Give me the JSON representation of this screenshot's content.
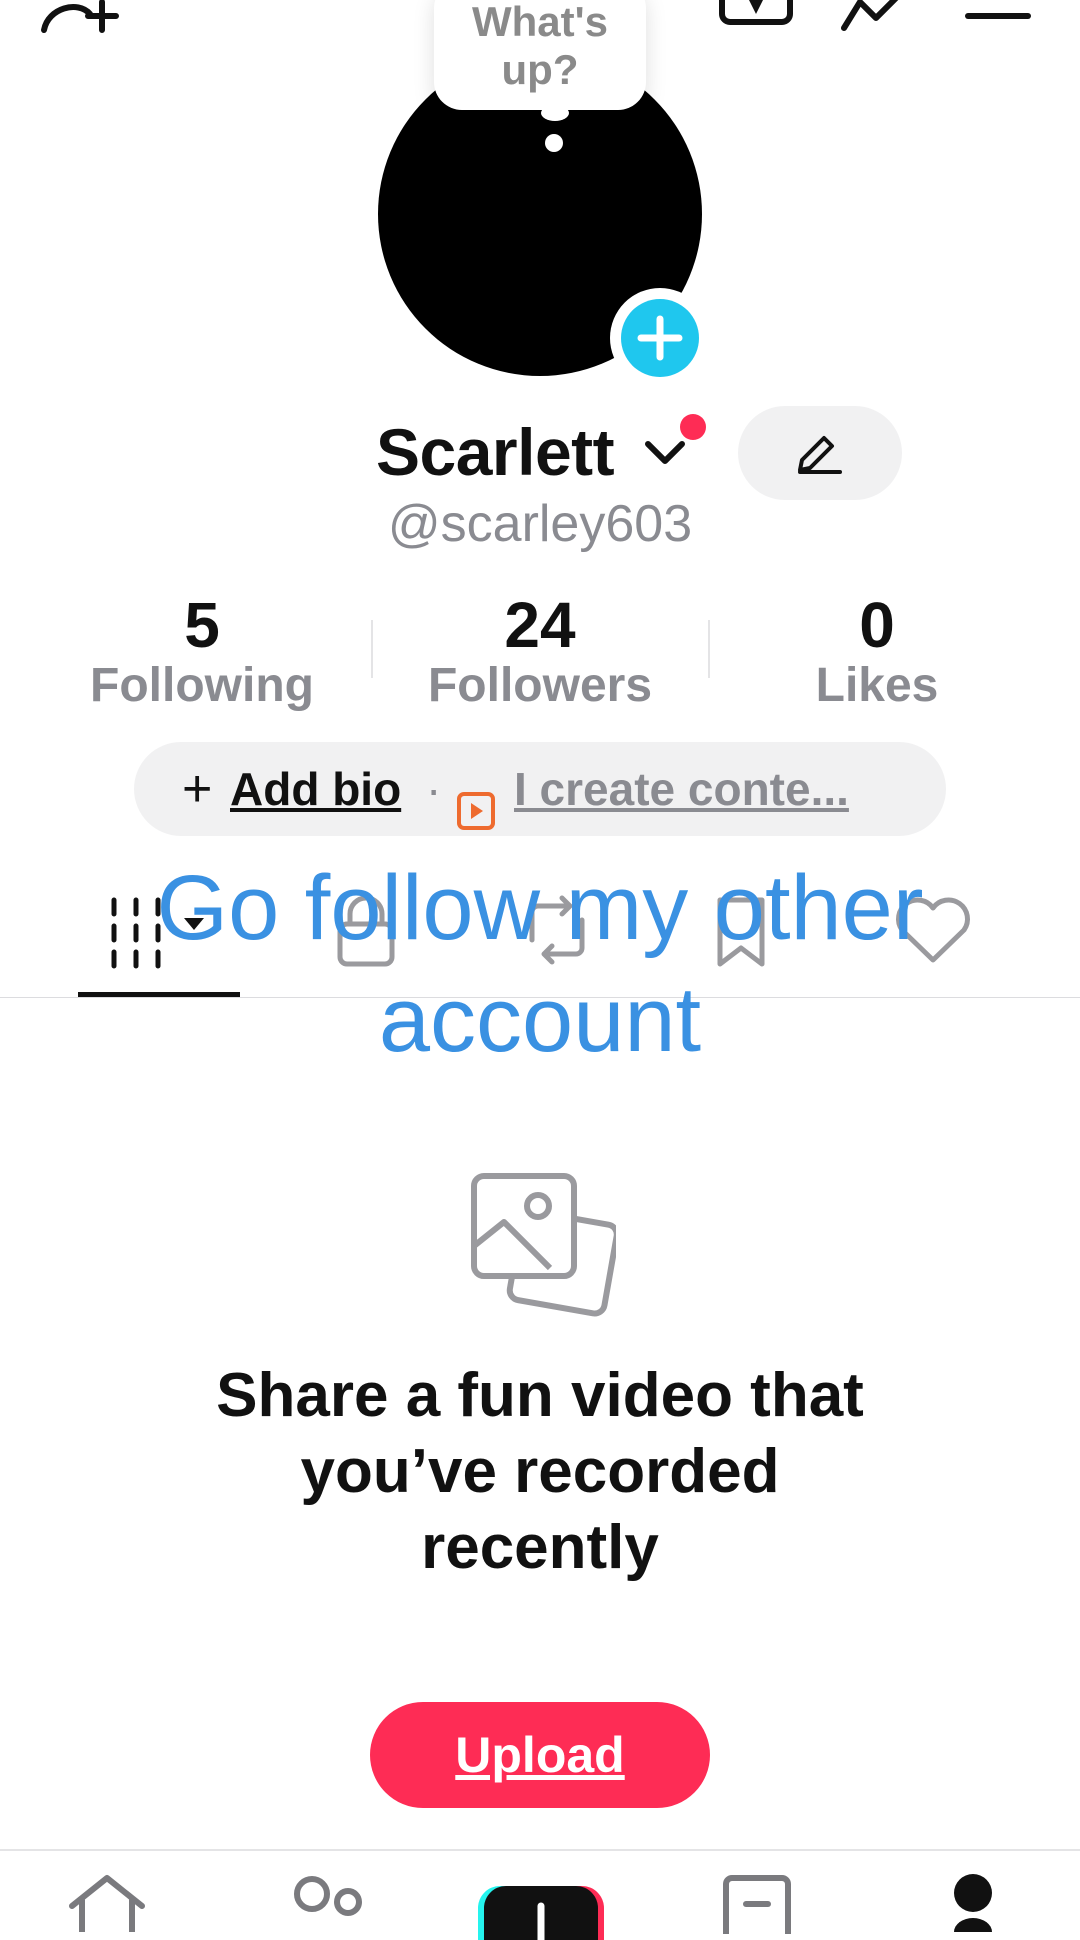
{
  "bubble": {
    "text": "What's up?"
  },
  "profile": {
    "name": "Scarlett",
    "handle": "@scarley603"
  },
  "stats": [
    {
      "value": "5",
      "label": "Following"
    },
    {
      "value": "24",
      "label": "Followers"
    },
    {
      "value": "0",
      "label": "Likes"
    }
  ],
  "bio": {
    "plus": "+",
    "add_label": "Add bio",
    "separator": "·",
    "create_label": "I create conte..."
  },
  "overlay": {
    "text": "Go follow my other account"
  },
  "empty_state": {
    "message": "Share a fun video that you’ve recorded recently",
    "upload_label": "Upload"
  },
  "colors": {
    "accent": "#fe2c55",
    "avatar_add": "#1fc7ee",
    "overlay_text": "#3a91e2",
    "secondary_text": "#8a8b91"
  },
  "icons": {
    "top_bar": [
      "add-friend-icon",
      "favorites-icon",
      "send-icon",
      "menu-icon"
    ],
    "tabs": [
      "videos-grid-icon",
      "lock-icon",
      "repost-icon",
      "bookmark-icon",
      "heart-icon"
    ],
    "bottom_nav": [
      "home-icon",
      "friends-icon",
      "create-icon",
      "inbox-icon",
      "profile-icon"
    ]
  }
}
